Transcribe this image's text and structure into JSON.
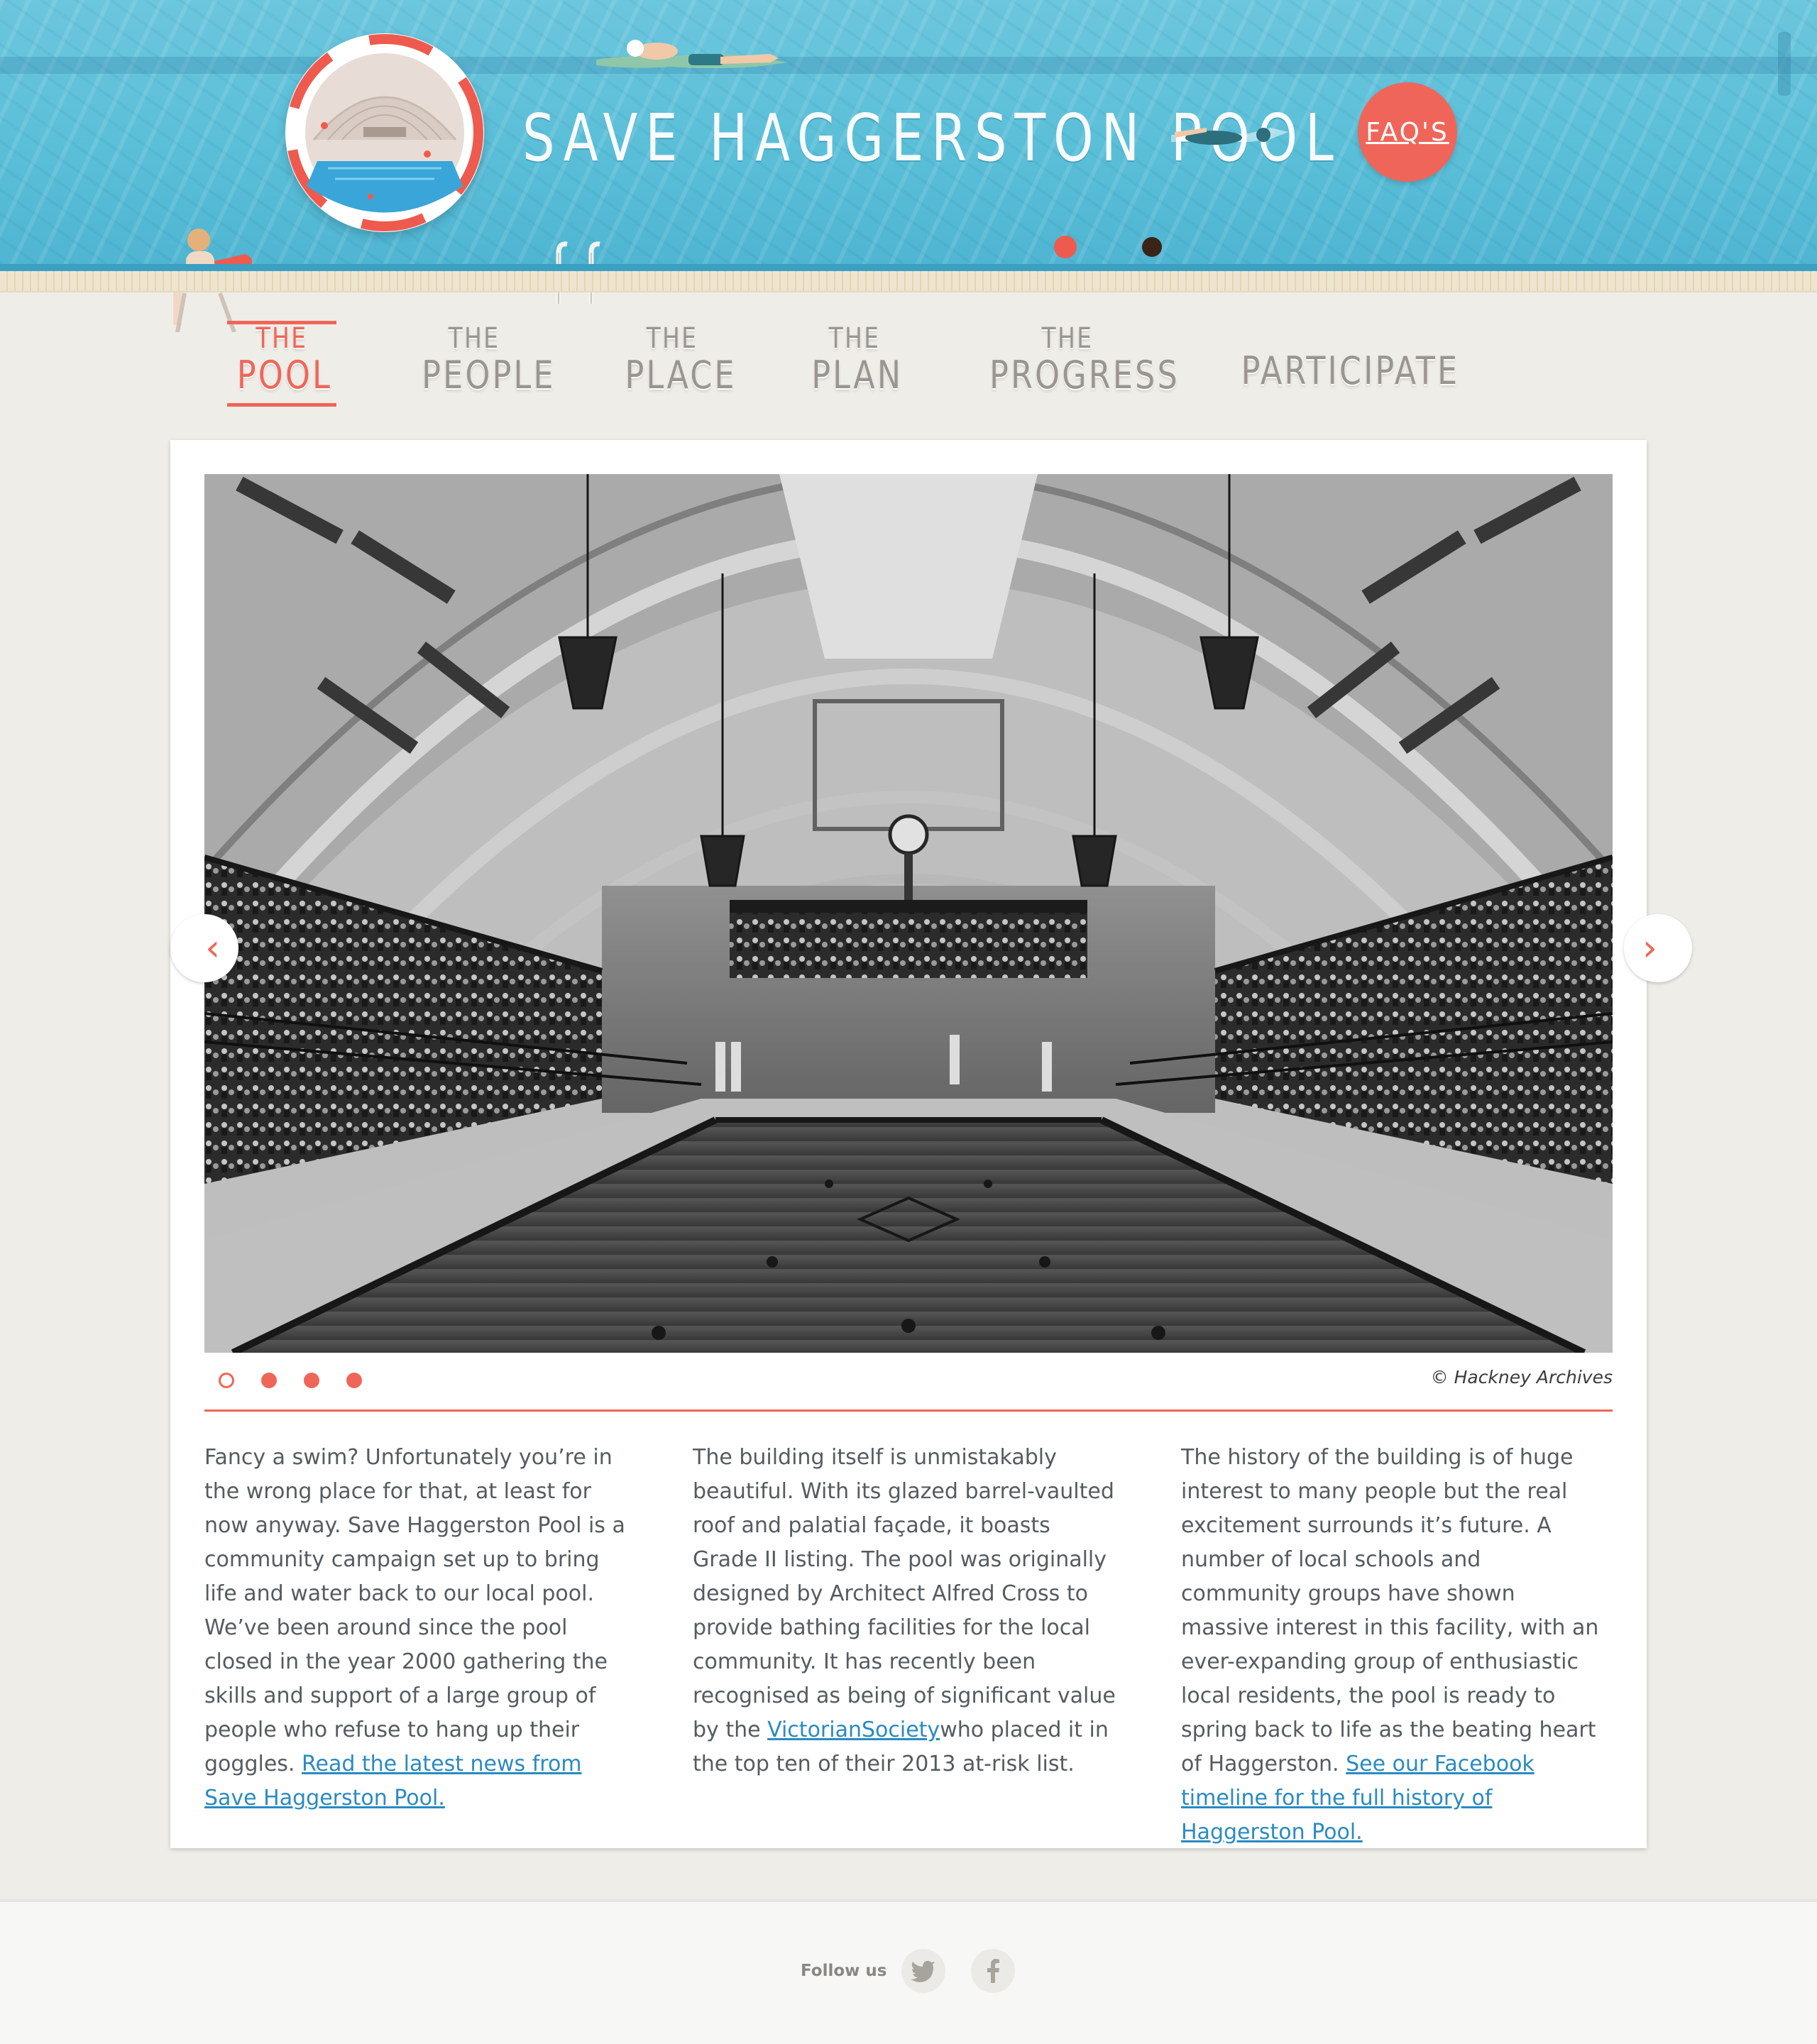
{
  "site": {
    "title": "SAVE HAGGERSTON POOL",
    "faq_label": "FAQ'S"
  },
  "nav": {
    "items": [
      {
        "small": "THE",
        "big": "POOL",
        "active": true
      },
      {
        "small": "THE",
        "big": "PEOPLE",
        "active": false
      },
      {
        "small": "THE",
        "big": "PLACE",
        "active": false
      },
      {
        "small": "THE",
        "big": "PLAN",
        "active": false
      },
      {
        "small": "THE",
        "big": "PROGRESS",
        "active": false
      },
      {
        "small": "",
        "big": "PARTICIPATE",
        "active": false
      }
    ]
  },
  "slideshow": {
    "credit": "© Hackney Archives",
    "prev_icon": "chevron-left-icon",
    "next_icon": "chevron-right-icon",
    "slide_count": 4,
    "active_index": 0
  },
  "columns": [
    {
      "text": "Fancy a swim? Unfortunately you’re in the wrong place for that, at least for now anyway. Save Haggerston Pool is a community campaign set up to bring life and water back to our local pool. We’ve been around since the pool closed in the year 2000 gathering the skills and support of a large group of people who refuse to hang up their goggles. ",
      "link": "Read the latest news from Save Haggerston Pool.",
      "after": ""
    },
    {
      "text": "The building itself is unmistakably beautiful. With its glazed barrel-vaulted roof and palatial façade, it boasts Grade II listing. The pool was originally designed by Architect Alfred Cross to provide bathing facilities for the local community. It has recently been recognised as being of significant value by the ",
      "link": "VictorianSociety",
      "after": "who placed it in the top ten of their 2013 at-risk list."
    },
    {
      "text": "The history of the building is of huge interest to many people but the real excitement surrounds it’s future. A number of local schools and community groups have shown massive interest in this facility, with an ever-expanding group of enthusiastic local residents, the pool is ready to spring back to life as the beating heart of Haggerston. ",
      "link": "See our Facebook timeline for the full history of Haggerston Pool.",
      "after": ""
    }
  ],
  "footer": {
    "follow_label": "Follow us",
    "twitter_glyph": "🐦",
    "facebook_glyph": "f",
    "social_icons": [
      "twitter-icon",
      "facebook-icon"
    ]
  },
  "colors": {
    "accent": "#ef6658",
    "pool_water": "#5bbfd8",
    "link": "#2a8bc0",
    "nav_inactive": "#9a9590"
  }
}
